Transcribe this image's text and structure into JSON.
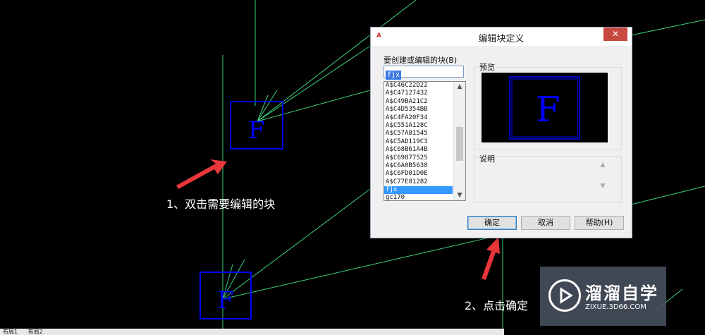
{
  "annotations": {
    "step1": "1、双击需要编辑的块",
    "step2": "2、点击确定"
  },
  "drawing": {
    "block_letter": "F"
  },
  "dialog": {
    "app_icon": "A",
    "title": "编辑块定义",
    "close_icon": "✕",
    "blocks_label": "要创建或编辑的块(B)",
    "block_name_value": "fjx",
    "block_list": [
      "A$C46C22D22",
      "A$C47127432",
      "A$C49BA21C2",
      "A$C4D5354BB",
      "A$C4FA20F34",
      "A$C551A128C",
      "A$C57A81545",
      "A$C5AD119C3",
      "A$C68B61A4B",
      "A$C69877525",
      "A$C6A0B5638",
      "A$C6FD01D0E",
      "A$C77E81282",
      "fjx",
      "gc170"
    ],
    "selected_item": "fjx",
    "preview_label": "预览",
    "preview_letter": "F",
    "description_label": "说明",
    "ok_button": "确定",
    "cancel_button": "取消",
    "help_button": "帮助(H)"
  },
  "watermark": {
    "name_cn": "溜溜自学",
    "site": "ZIXUE.3D66.COM"
  },
  "layout_tabs": [
    "布局1",
    "布局2"
  ],
  "colors": {
    "background": "#000000",
    "line_green": "#3fd27a",
    "block_blue": "#0000ff",
    "annotation_arrow": "#e8363a",
    "selection": "#3399ff"
  }
}
